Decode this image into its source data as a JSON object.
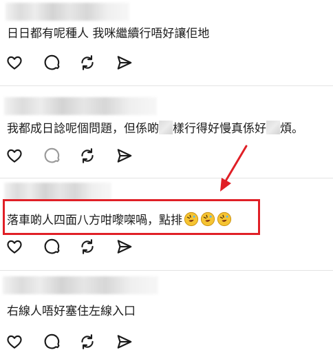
{
  "posts": [
    {
      "text": "日日都有呢種人 我咪繼續行唔好讓佢地"
    },
    {
      "text_a": "我都成日諗呢個問題，但係啲",
      "text_b": "樣行得好慢真係好",
      "text_c": "煩。"
    },
    {
      "text": "落車啲人四面八方咁嚟㗎喎，點排"
    },
    {
      "text": "右線人唔好塞住左線入口"
    }
  ],
  "icons": {
    "like": "heart-icon",
    "reply": "comment-bubble-icon",
    "repost": "repost-icon",
    "share": "send-icon",
    "emoji": "rolling-on-floor-laughing-emoji"
  },
  "colors": {
    "annotation": "#e01f26",
    "icon": "#1a1a1a",
    "divider": "#e3e3e3"
  }
}
